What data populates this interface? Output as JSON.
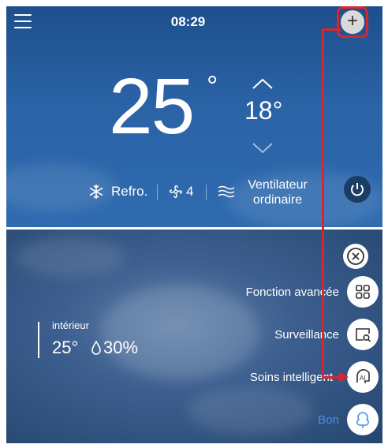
{
  "header": {
    "time": "08:29"
  },
  "climate": {
    "current_temp": "25",
    "degree": "°",
    "set_temp": "18°",
    "mode_label": "Refro.",
    "fan_speed": "4",
    "wind_label_line1": "Ventilateur",
    "wind_label_line2": "ordinaire"
  },
  "indoor": {
    "label": "intérieur",
    "temp": "25°",
    "humidity": "30%"
  },
  "menu": {
    "items": [
      {
        "label": "Fonction avancée"
      },
      {
        "label": "Surveillance"
      },
      {
        "label": "Soins intelligent"
      },
      {
        "label": "Bon"
      }
    ]
  },
  "colors": {
    "accent_red": "#d9262c",
    "panel_blue": "#2a63a6",
    "air_quality_good": "#4a90e2"
  },
  "icons": [
    "menu-icon",
    "add-icon",
    "chevron-up-icon",
    "chevron-down-icon",
    "snowflake-icon",
    "fan-icon",
    "wind-icon",
    "power-icon",
    "close-icon",
    "grid-icon",
    "monitor-search-icon",
    "ai-icon",
    "tree-icon",
    "droplet-icon"
  ]
}
